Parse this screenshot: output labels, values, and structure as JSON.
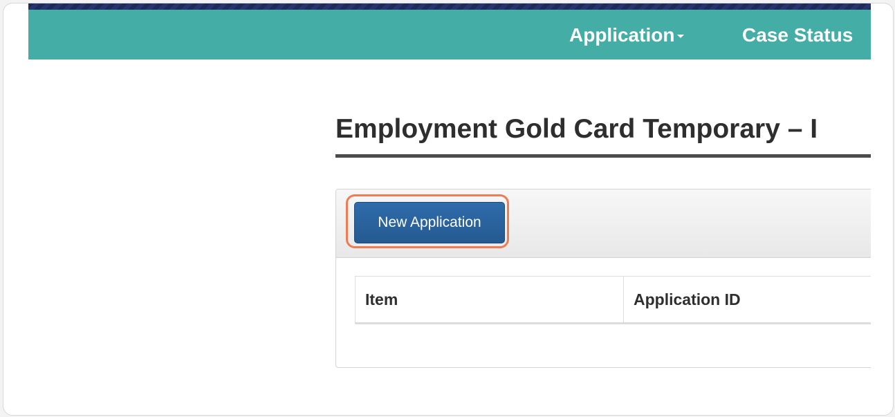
{
  "nav": {
    "items": [
      {
        "label": "Application",
        "has_dropdown": true
      },
      {
        "label": "Case Status",
        "has_dropdown": false
      }
    ],
    "background_color": "#43ada6"
  },
  "page": {
    "title": "Employment Gold Card Temporary – I"
  },
  "panel": {
    "new_application_label": "New Application",
    "highlight_color": "#f07a52",
    "button_color": "#2a629e"
  },
  "table": {
    "columns": [
      "Item",
      "Application ID"
    ]
  },
  "icons": {
    "dropdown": "chevron-down-icon"
  }
}
